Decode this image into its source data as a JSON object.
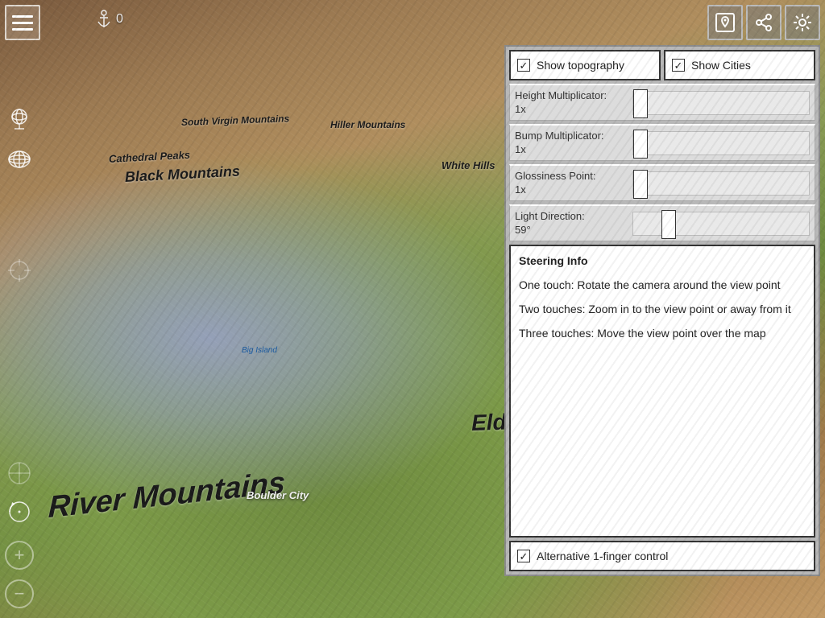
{
  "anchor": {
    "value": "0"
  },
  "map_labels": {
    "river_mountains": "River Mountains",
    "black_mountains": "Black Mountains",
    "cathedral_peaks": "Cathedral Peaks",
    "south_virgin": "South Virgin Mountains",
    "hiller": "Hiller Mountains",
    "white_hills": "White Hills",
    "eldorado": "Eldorado Mountains",
    "boulder_city": "Boulder City",
    "big_island": "Big Island"
  },
  "panel": {
    "show_topography": {
      "label": "Show topography",
      "checked": true
    },
    "show_cities": {
      "label": "Show Cities",
      "checked": true
    },
    "sliders": {
      "height": {
        "label": "Height Multiplicator:",
        "value": "1x",
        "pos_pct": 0
      },
      "bump": {
        "label": "Bump Multiplicator:",
        "value": "1x",
        "pos_pct": 0
      },
      "gloss": {
        "label": "Glossiness Point:",
        "value": "1x",
        "pos_pct": 0
      },
      "light": {
        "label": "Light Direction:",
        "value": "59°",
        "pos_pct": 16
      }
    },
    "info": {
      "title": "Steering Info",
      "line1": "One touch: Rotate the camera around the view point",
      "line2": "Two touches: Zoom in to the view point or away from it",
      "line3": "Three touches: Move the view point over the map"
    },
    "alt_control": {
      "label": "Alternative 1-finger control",
      "checked": true
    }
  }
}
